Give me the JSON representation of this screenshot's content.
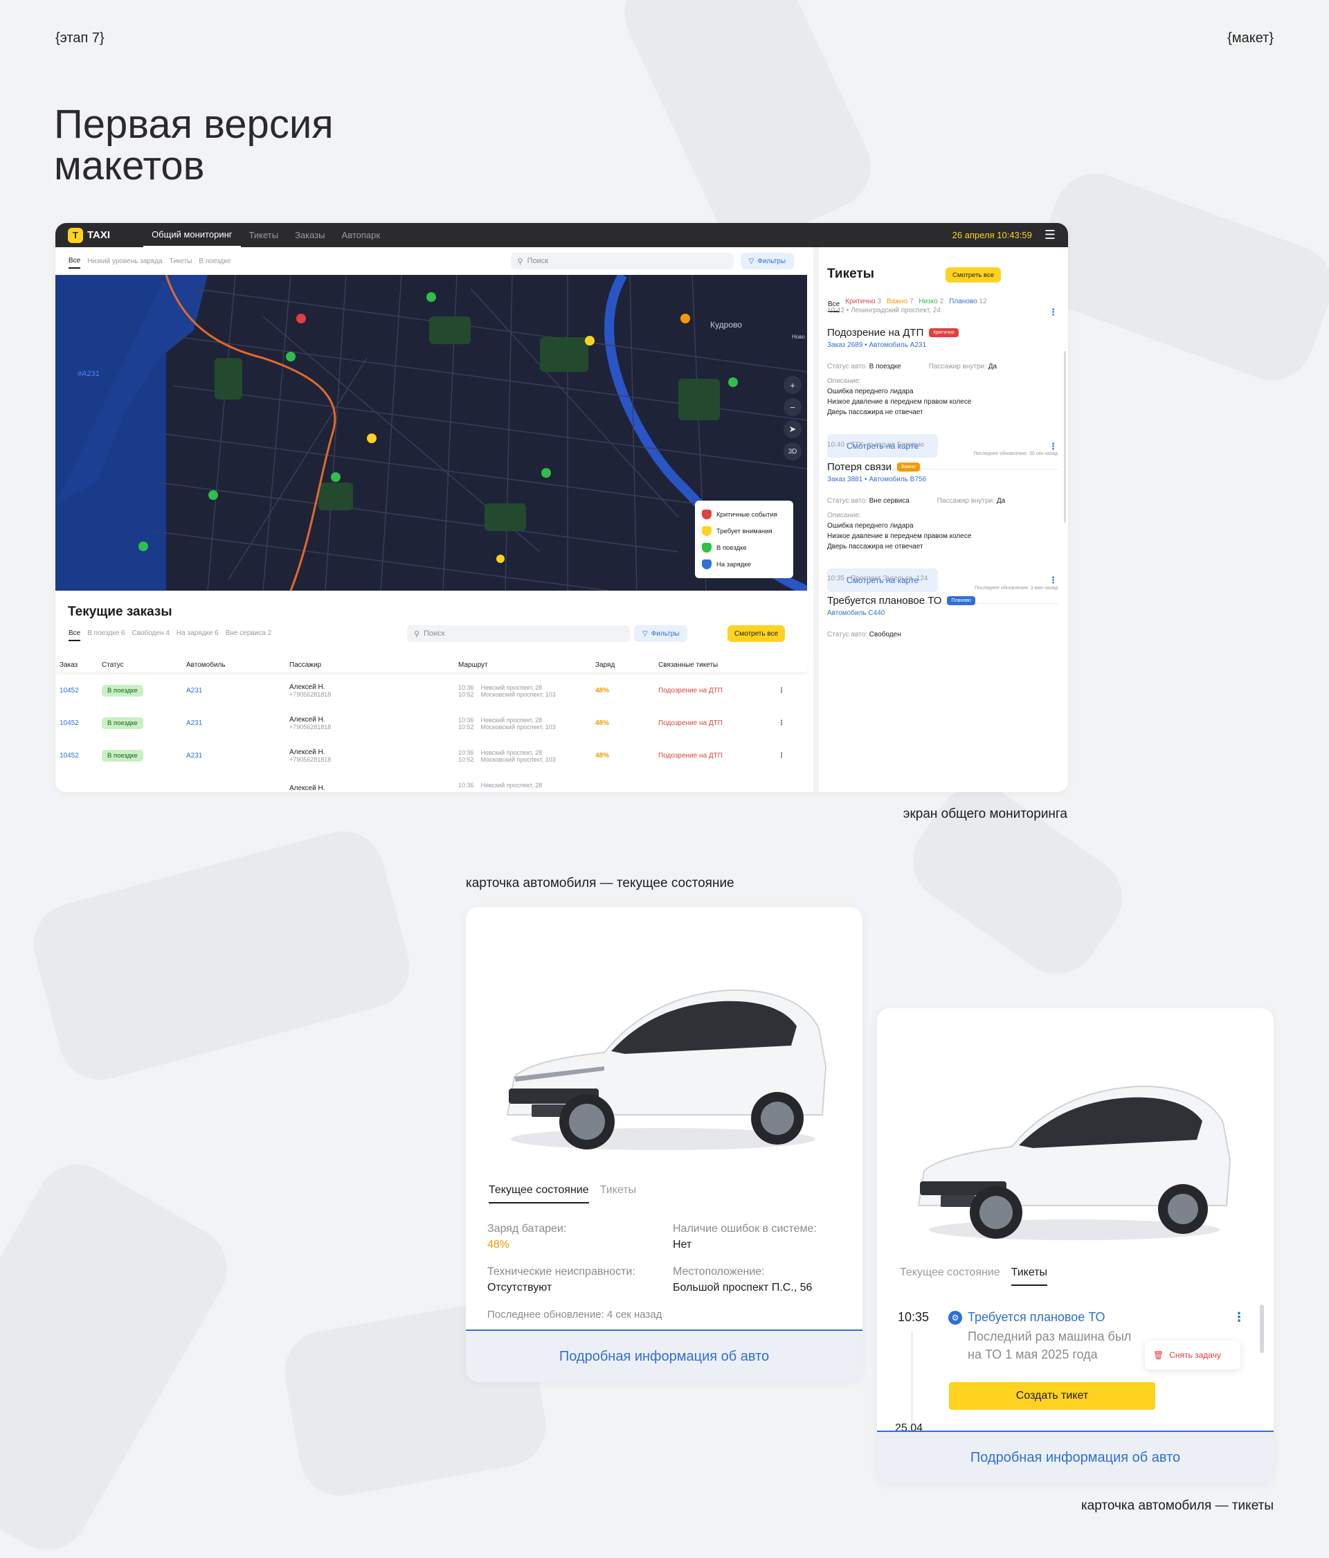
{
  "header": {
    "stage": "{этап 7}",
    "label": "{макет}",
    "title_line1": "Первая версия",
    "title_line2": "макетов"
  },
  "dashboard": {
    "logo": "TAXI",
    "nav": [
      "Общий мониторинг",
      "Тикеты",
      "Заказы",
      "Автопарк"
    ],
    "datetime": "26 апреля 10:43:59",
    "map_tabs": [
      "Все",
      "Низкий уровень заряда",
      "Тикеты",
      "В поездке"
    ],
    "search_placeholder": "Поиск",
    "filters_label": "Фильтры",
    "map_labels": {
      "kudrovo": "Кудрово",
      "a231": "#A231",
      "novo": "Ново"
    },
    "zoom": {
      "plus": "+",
      "minus": "−",
      "d3": "3D"
    },
    "legend": [
      "Критичные события",
      "Требует внимания",
      "В поездке",
      "На зарядке"
    ],
    "colors": {
      "critical": "#e04040",
      "attention": "#ffd21f",
      "ride": "#2fbf4a",
      "charging": "#2f6fd6",
      "accent": "#ffd21f"
    },
    "orders": {
      "title": "Текущие заказы",
      "tabs": [
        {
          "label": "Все",
          "count": ""
        },
        {
          "label": "В поездке",
          "count": "6"
        },
        {
          "label": "Свободен",
          "count": "4"
        },
        {
          "label": "На зарядке",
          "count": "6"
        },
        {
          "label": "Вне сервиса",
          "count": "2"
        }
      ],
      "view_all": "Смотреть все",
      "columns": [
        "Заказ",
        "Статус",
        "Автомобиль",
        "Пассажир",
        "Маршрут",
        "Заряд",
        "Связанные тикеты"
      ],
      "rows": [
        {
          "order": "10452",
          "status": "В поездке",
          "car": "A231",
          "passenger": "Алексей Н.",
          "phone": "+79056281818",
          "t1": "10:36",
          "from": "Невский проспект, 28",
          "t2": "10:52",
          "to": "Московский проспект, 103",
          "charge": "48%",
          "ticket": "Подозрение на ДТП"
        },
        {
          "order": "10452",
          "status": "В поездке",
          "car": "A231",
          "passenger": "Алексей Н.",
          "phone": "+79056281818",
          "t1": "10:36",
          "from": "Невский проспект, 28",
          "t2": "10:52",
          "to": "Московский проспект, 103",
          "charge": "48%",
          "ticket": "Подозрение на ДТП"
        },
        {
          "order": "10452",
          "status": "В поездке",
          "car": "A231",
          "passenger": "Алексей Н.",
          "phone": "+79056281818",
          "t1": "10:36",
          "from": "Невский проспект, 28",
          "t2": "10:52",
          "to": "Московский проспект, 103",
          "charge": "48%",
          "ticket": "Подозрение на ДТП"
        },
        {
          "order": "",
          "status": "",
          "car": "",
          "passenger": "Алексей Н.",
          "phone": "",
          "t1": "10:36",
          "from": "Невский проспект, 28",
          "t2": "",
          "to": "",
          "charge": "",
          "ticket": ""
        }
      ]
    },
    "tickets": {
      "title": "Тикеты",
      "view_all": "Смотреть все",
      "tabs": [
        {
          "label": "Все",
          "count": ""
        },
        {
          "label": "Критично",
          "count": "3"
        },
        {
          "label": "Важно",
          "count": "7"
        },
        {
          "label": "Низко",
          "count": "2"
        },
        {
          "label": "Планово",
          "count": "12"
        }
      ],
      "items": [
        {
          "meta": "10:42 • Ленинградский проспект, 24",
          "name": "Подозрение на ДТП",
          "tag": "Критично",
          "tag_color": "#e04040",
          "link": "Заказ 2689 • Автомобиль A231",
          "status_label": "Статус авто:",
          "status": "В поездке",
          "pass_label": "Пассажир внутри:",
          "pass": "Да",
          "desc_label": "Описание:",
          "desc": [
            "Ошибка переднего лидара",
            "Низкое давление в переднем правом колесе",
            "Дверь пассажира не отвечает"
          ],
          "button": "Смотреть на карте",
          "updated": "Последнее обновление: 30 сек назад"
        },
        {
          "meta": "10:40 • ТТК, съезд на Беговую",
          "name": "Потеря связи",
          "tag": "Важно",
          "tag_color": "#f39a05",
          "link": "Заказ 3881 • Автомобиль B756",
          "status_label": "Статус авто:",
          "status": "Вне сервиса",
          "pass_label": "Пассажир внутри:",
          "pass": "Да",
          "desc_label": "Описание:",
          "desc": [
            "Ошибка переднего лидара",
            "Низкое давление в переднем правом колесе",
            "Дверь пассажира не отвечает"
          ],
          "button": "Смотреть на карте",
          "updated": "Последнее обновление: 3 мин назад"
        },
        {
          "meta": "10:35 • Проспект Энгельса, 124",
          "name": "Требуется плановое ТО",
          "tag": "Планово",
          "tag_color": "#2f6fd6",
          "link": "Автомобиль C440",
          "status_label": "Статус авто:",
          "status": "Свободен"
        }
      ]
    },
    "caption": "экран общего мониторинга"
  },
  "card_state": {
    "caption": "карточка автомобиля — текущее состояние",
    "tabs": [
      "Текущее состояние",
      "Тикеты"
    ],
    "battery_label": "Заряд батареи:",
    "battery": "48%",
    "errors_label": "Наличие ошибок в системе:",
    "errors": "Нет",
    "faults_label": "Технические неисправности:",
    "faults": "Отсутствуют",
    "location_label": "Местоположение:",
    "location": "Большой проспект П.С., 56",
    "updated": "Последнее обновление: 4 сек назад",
    "footer": "Подробная информация об авто"
  },
  "card_tickets": {
    "caption": "карточка автомобиля — тикеты",
    "tabs": [
      "Текущее состояние",
      "Тикеты"
    ],
    "time": "10:35",
    "ticket_name": "Требуется плановое ТО",
    "ticket_text_1": "Последний раз машина был",
    "ticket_text_2": "на ТО 1 мая 2025 года",
    "remove_task": "Снять задачу",
    "create_ticket": "Создать тикет",
    "date": "25.04",
    "footer": "Подробная информация об авто"
  }
}
